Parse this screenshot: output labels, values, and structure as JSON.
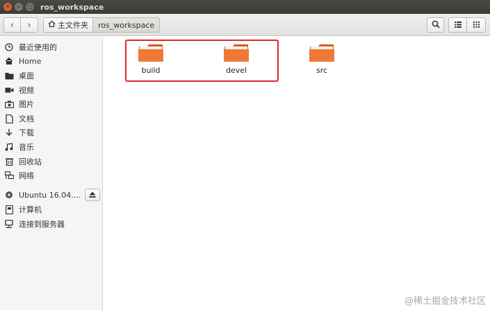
{
  "window": {
    "title": "ros_workspace"
  },
  "toolbar": {
    "breadcrumbs": [
      {
        "label": "主文件夹",
        "icon": "home-icon"
      },
      {
        "label": "ros_workspace"
      }
    ]
  },
  "sidebar": {
    "items": [
      {
        "label": "最近使用的",
        "icon": "clock-icon"
      },
      {
        "label": "Home",
        "icon": "home-icon"
      },
      {
        "label": "桌面",
        "icon": "folder-icon"
      },
      {
        "label": "视频",
        "icon": "video-icon"
      },
      {
        "label": "图片",
        "icon": "camera-icon"
      },
      {
        "label": "文档",
        "icon": "document-icon"
      },
      {
        "label": "下载",
        "icon": "download-icon"
      },
      {
        "label": "音乐",
        "icon": "music-icon"
      },
      {
        "label": "回收站",
        "icon": "trash-icon"
      },
      {
        "label": "网络",
        "icon": "network-icon"
      }
    ],
    "devices": [
      {
        "label": "Ubuntu 16.04....",
        "icon": "disc-icon"
      },
      {
        "label": "计算机",
        "icon": "computer-icon"
      },
      {
        "label": "连接到服务器",
        "icon": "server-icon"
      }
    ]
  },
  "main": {
    "folders": [
      {
        "name": "build"
      },
      {
        "name": "devel"
      },
      {
        "name": "src"
      }
    ]
  },
  "colors": {
    "accent": "#e05d2b",
    "folder": "#ef7a38",
    "highlight": "#e3262a"
  },
  "watermark": "@稀土掘金技术社区"
}
